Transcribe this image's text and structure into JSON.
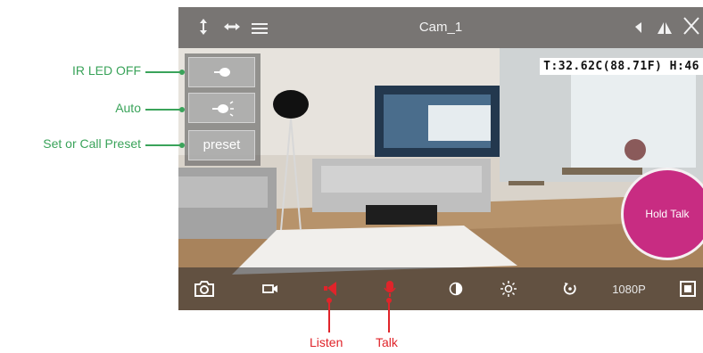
{
  "window": {
    "title": "Cam_1"
  },
  "sensor_readout": "T:32.62C(88.71F) H:46",
  "top_icons": [
    "flip-vertical-icon",
    "flip-horizontal-icon",
    "menu-icon",
    "speaker-icon",
    "signal-icon",
    "close-icon"
  ],
  "side_panel": {
    "buttons": [
      {
        "icon": "ir-led-off-icon"
      },
      {
        "icon": "ir-led-auto-icon"
      },
      {
        "label": "preset"
      }
    ]
  },
  "callouts_left": [
    "IR LED OFF",
    "Auto",
    "Set or Call Preset"
  ],
  "callouts_bottom": [
    "Listen",
    "Talk"
  ],
  "hold_talk": {
    "label": "Hold Talk",
    "color": "#c82c82"
  },
  "bottom_toolbar": {
    "items": [
      "camera-icon",
      "video-record-icon",
      "listen-speaker-icon",
      "microphone-icon",
      "contrast-icon",
      "brightness-icon",
      "rotate-icon",
      "resolution",
      "fullscreen-icon"
    ],
    "resolution": "1080P"
  },
  "colors": {
    "callout_green": "#3aa35a",
    "callout_red": "#e0242a",
    "active_red": "#e0242a"
  }
}
